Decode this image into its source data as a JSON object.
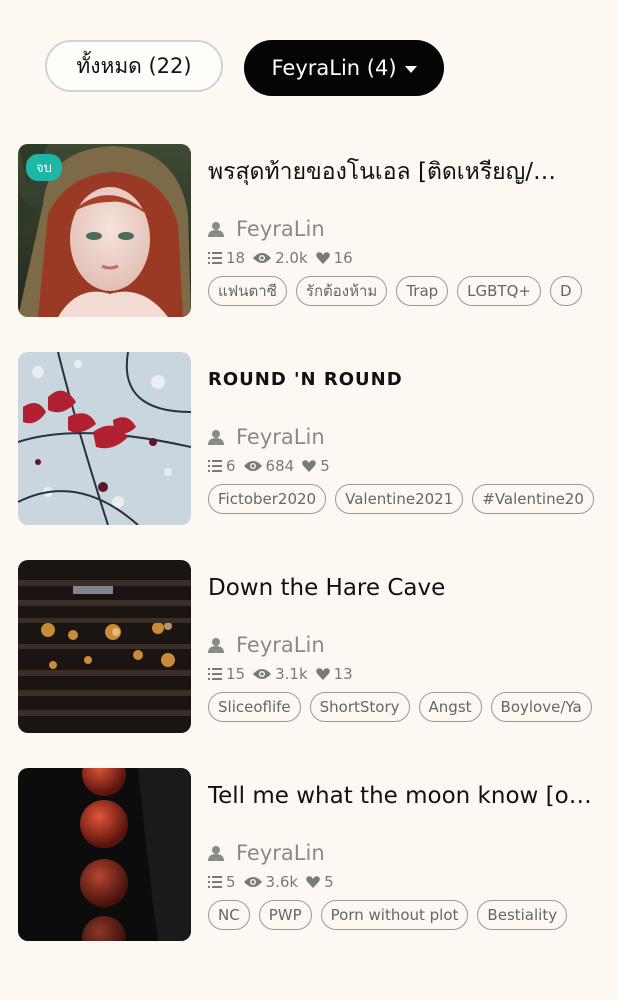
{
  "filters": {
    "all_label": "ทั้งหมด (22)",
    "author_label": "FeyraLin (4)"
  },
  "stories": [
    {
      "title": "พรสุดท้ายของโนเอล [ติดเหรียญ/…",
      "badge": "จบ",
      "author": "FeyraLin",
      "chapters": "18",
      "views": "2.0k",
      "likes": "16",
      "tags": [
        "แฟนตาซี",
        "รักต้องห้าม",
        "Trap",
        "LGBTQ+",
        "D"
      ]
    },
    {
      "title": "ROUND 'N ROUND",
      "author": "FeyraLin",
      "chapters": "6",
      "views": "684",
      "likes": "5",
      "tags": [
        "Fictober2020",
        "Valentine2021",
        "#Valentine20"
      ]
    },
    {
      "title": "Down the Hare Cave",
      "author": "FeyraLin",
      "chapters": "15",
      "views": "3.1k",
      "likes": "13",
      "tags": [
        "Sliceoflife",
        "ShortStory",
        "Angst",
        "Boylove/Ya"
      ]
    },
    {
      "title": "Tell me what the moon know [o…",
      "author": "FeyraLin",
      "chapters": "5",
      "views": "3.6k",
      "likes": "5",
      "tags": [
        "NC",
        "PWP",
        "Porn without plot",
        "Bestiality"
      ]
    }
  ]
}
